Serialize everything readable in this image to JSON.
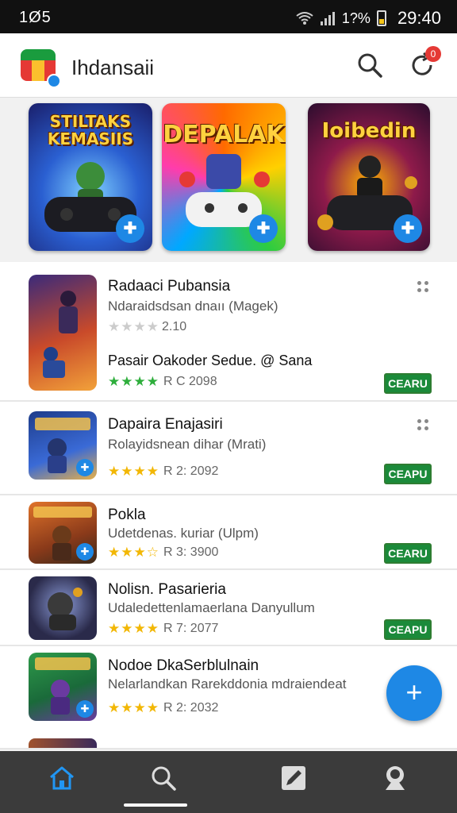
{
  "status_bar": {
    "left_text": "1Ø5",
    "battery_text": "1?%",
    "time": "29:40"
  },
  "app_bar": {
    "title": "Ihdansaii",
    "notification_count": "0"
  },
  "featured": [
    {
      "title": "STILTAKS KEMASIIS",
      "fab_symbol": "✚"
    },
    {
      "title": "DEPALAK",
      "fab_symbol": "✚"
    },
    {
      "title": "Ioibedin",
      "fab_symbol": "✚"
    }
  ],
  "list": [
    {
      "title": "Radaaci Pubansia",
      "subtitle": "Ndaraidsdsan dnaıı (Magek)",
      "stars_filled": 0,
      "stars_total": 4,
      "rating_text": "2.10",
      "has_more": true,
      "extra_title": "Pasair Oakoder Sedue. @ Sana",
      "extra_stars": "★★★★",
      "extra_rating": "R C 2098",
      "button": "CEARU"
    },
    {
      "title": "Dapaira Enajasiri",
      "subtitle": "Rolayidsnean dihar (Mrati)",
      "stars": "★★★★",
      "rating_text": "R 2: 2092",
      "has_more": true,
      "button": "CEAPU"
    },
    {
      "title": "Pokla",
      "subtitle": "Udetdenas. kuriar (Ulpm)",
      "stars": "★★★☆",
      "rating_text": "R 3: 3900",
      "button": "CEARU"
    },
    {
      "title": "Nolisn. Pasarieria",
      "subtitle": "Udaledettenlamaerlana Danyullum",
      "stars": "★★★★",
      "rating_text": "R 7: 2077",
      "button": "CEAPU"
    },
    {
      "title": "Nodoe DkaSerblulnain",
      "subtitle": "Nelarlandkan Rarekddonia mdraiendeat",
      "stars": "★★★★",
      "rating_text": "R 2: 2032"
    }
  ],
  "fab_label": "+",
  "nav": [
    "home-icon",
    "search-icon",
    "edit-icon",
    "profile-icon"
  ],
  "colors": {
    "accent": "#1e88e5",
    "green_button": "#1b8a3a",
    "star": "#f2b705",
    "star_green": "#2eae3c",
    "nav_bg": "#3b3b3b"
  }
}
